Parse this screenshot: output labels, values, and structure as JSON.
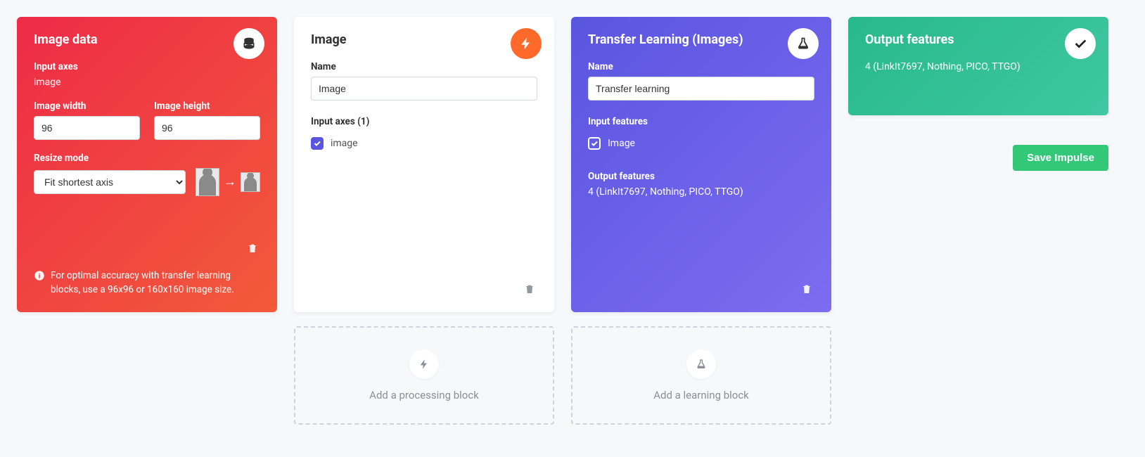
{
  "input_card": {
    "title": "Image data",
    "icon": "database-icon",
    "input_axes_label": "Input axes",
    "input_axes_value": "image",
    "width_label": "Image width",
    "width_value": "96",
    "height_label": "Image height",
    "height_value": "96",
    "resize_label": "Resize mode",
    "resize_value": "Fit shortest axis",
    "info_text": "For optimal accuracy with transfer learning blocks, use a 96x96 or 160x160 image size."
  },
  "processing_card": {
    "title": "Image",
    "icon": "bolt-icon",
    "name_label": "Name",
    "name_value": "Image",
    "axes_label": "Input axes (1)",
    "axes_item": "image"
  },
  "learning_card": {
    "title": "Transfer Learning (Images)",
    "icon": "flask-icon",
    "name_label": "Name",
    "name_value": "Transfer learning",
    "input_features_label": "Input features",
    "input_features_item": "Image",
    "output_features_label": "Output features",
    "output_features_value": "4 (LinkIt7697, Nothing, PICO, TTGO)"
  },
  "output_card": {
    "title": "Output features",
    "icon": "check-icon",
    "value": "4 (LinkIt7697, Nothing, PICO, TTGO)"
  },
  "add_processing": "Add a processing block",
  "add_learning": "Add a learning block",
  "save_button": "Save Impulse"
}
